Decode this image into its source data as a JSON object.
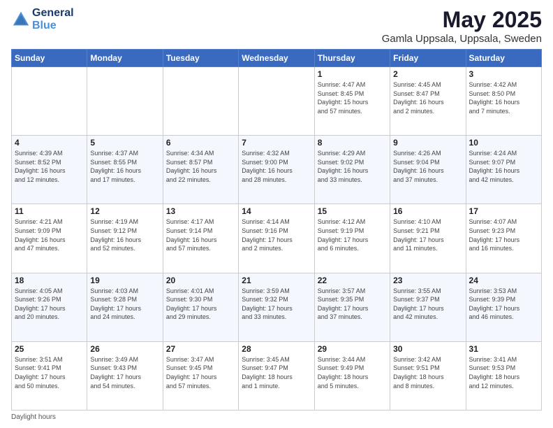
{
  "header": {
    "logo_line1": "General",
    "logo_line2": "Blue",
    "title": "May 2025",
    "subtitle": "Gamla Uppsala, Uppsala, Sweden"
  },
  "days_of_week": [
    "Sunday",
    "Monday",
    "Tuesday",
    "Wednesday",
    "Thursday",
    "Friday",
    "Saturday"
  ],
  "weeks": [
    [
      {
        "num": "",
        "info": ""
      },
      {
        "num": "",
        "info": ""
      },
      {
        "num": "",
        "info": ""
      },
      {
        "num": "",
        "info": ""
      },
      {
        "num": "1",
        "info": "Sunrise: 4:47 AM\nSunset: 8:45 PM\nDaylight: 15 hours\nand 57 minutes."
      },
      {
        "num": "2",
        "info": "Sunrise: 4:45 AM\nSunset: 8:47 PM\nDaylight: 16 hours\nand 2 minutes."
      },
      {
        "num": "3",
        "info": "Sunrise: 4:42 AM\nSunset: 8:50 PM\nDaylight: 16 hours\nand 7 minutes."
      }
    ],
    [
      {
        "num": "4",
        "info": "Sunrise: 4:39 AM\nSunset: 8:52 PM\nDaylight: 16 hours\nand 12 minutes."
      },
      {
        "num": "5",
        "info": "Sunrise: 4:37 AM\nSunset: 8:55 PM\nDaylight: 16 hours\nand 17 minutes."
      },
      {
        "num": "6",
        "info": "Sunrise: 4:34 AM\nSunset: 8:57 PM\nDaylight: 16 hours\nand 22 minutes."
      },
      {
        "num": "7",
        "info": "Sunrise: 4:32 AM\nSunset: 9:00 PM\nDaylight: 16 hours\nand 28 minutes."
      },
      {
        "num": "8",
        "info": "Sunrise: 4:29 AM\nSunset: 9:02 PM\nDaylight: 16 hours\nand 33 minutes."
      },
      {
        "num": "9",
        "info": "Sunrise: 4:26 AM\nSunset: 9:04 PM\nDaylight: 16 hours\nand 37 minutes."
      },
      {
        "num": "10",
        "info": "Sunrise: 4:24 AM\nSunset: 9:07 PM\nDaylight: 16 hours\nand 42 minutes."
      }
    ],
    [
      {
        "num": "11",
        "info": "Sunrise: 4:21 AM\nSunset: 9:09 PM\nDaylight: 16 hours\nand 47 minutes."
      },
      {
        "num": "12",
        "info": "Sunrise: 4:19 AM\nSunset: 9:12 PM\nDaylight: 16 hours\nand 52 minutes."
      },
      {
        "num": "13",
        "info": "Sunrise: 4:17 AM\nSunset: 9:14 PM\nDaylight: 16 hours\nand 57 minutes."
      },
      {
        "num": "14",
        "info": "Sunrise: 4:14 AM\nSunset: 9:16 PM\nDaylight: 17 hours\nand 2 minutes."
      },
      {
        "num": "15",
        "info": "Sunrise: 4:12 AM\nSunset: 9:19 PM\nDaylight: 17 hours\nand 6 minutes."
      },
      {
        "num": "16",
        "info": "Sunrise: 4:10 AM\nSunset: 9:21 PM\nDaylight: 17 hours\nand 11 minutes."
      },
      {
        "num": "17",
        "info": "Sunrise: 4:07 AM\nSunset: 9:23 PM\nDaylight: 17 hours\nand 16 minutes."
      }
    ],
    [
      {
        "num": "18",
        "info": "Sunrise: 4:05 AM\nSunset: 9:26 PM\nDaylight: 17 hours\nand 20 minutes."
      },
      {
        "num": "19",
        "info": "Sunrise: 4:03 AM\nSunset: 9:28 PM\nDaylight: 17 hours\nand 24 minutes."
      },
      {
        "num": "20",
        "info": "Sunrise: 4:01 AM\nSunset: 9:30 PM\nDaylight: 17 hours\nand 29 minutes."
      },
      {
        "num": "21",
        "info": "Sunrise: 3:59 AM\nSunset: 9:32 PM\nDaylight: 17 hours\nand 33 minutes."
      },
      {
        "num": "22",
        "info": "Sunrise: 3:57 AM\nSunset: 9:35 PM\nDaylight: 17 hours\nand 37 minutes."
      },
      {
        "num": "23",
        "info": "Sunrise: 3:55 AM\nSunset: 9:37 PM\nDaylight: 17 hours\nand 42 minutes."
      },
      {
        "num": "24",
        "info": "Sunrise: 3:53 AM\nSunset: 9:39 PM\nDaylight: 17 hours\nand 46 minutes."
      }
    ],
    [
      {
        "num": "25",
        "info": "Sunrise: 3:51 AM\nSunset: 9:41 PM\nDaylight: 17 hours\nand 50 minutes."
      },
      {
        "num": "26",
        "info": "Sunrise: 3:49 AM\nSunset: 9:43 PM\nDaylight: 17 hours\nand 54 minutes."
      },
      {
        "num": "27",
        "info": "Sunrise: 3:47 AM\nSunset: 9:45 PM\nDaylight: 17 hours\nand 57 minutes."
      },
      {
        "num": "28",
        "info": "Sunrise: 3:45 AM\nSunset: 9:47 PM\nDaylight: 18 hours\nand 1 minute."
      },
      {
        "num": "29",
        "info": "Sunrise: 3:44 AM\nSunset: 9:49 PM\nDaylight: 18 hours\nand 5 minutes."
      },
      {
        "num": "30",
        "info": "Sunrise: 3:42 AM\nSunset: 9:51 PM\nDaylight: 18 hours\nand 8 minutes."
      },
      {
        "num": "31",
        "info": "Sunrise: 3:41 AM\nSunset: 9:53 PM\nDaylight: 18 hours\nand 12 minutes."
      }
    ]
  ],
  "footer": "Daylight hours"
}
